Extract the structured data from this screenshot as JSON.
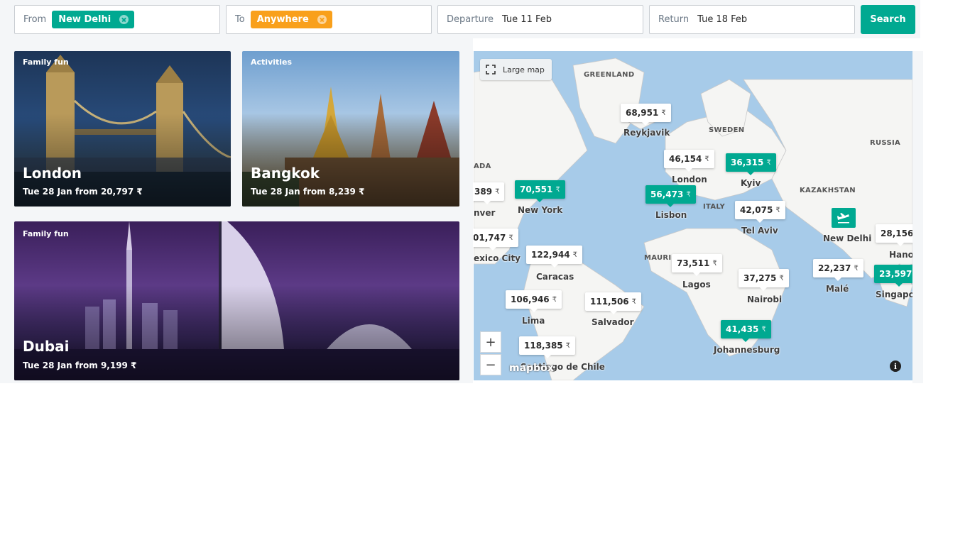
{
  "search": {
    "from_label": "From",
    "from_value": "New Delhi",
    "to_label": "To",
    "to_value": "Anywhere",
    "departure_label": "Departure",
    "departure_value": "Tue 11 Feb",
    "return_label": "Return",
    "return_value": "Tue 18 Feb",
    "search_button": "Search"
  },
  "cards": [
    {
      "tag": "Family fun",
      "city": "London",
      "price": "Tue 28 Jan from 20,797 ₹"
    },
    {
      "tag": "Activities",
      "city": "Bangkok",
      "price": "Tue 28 Jan from 8,239 ₹"
    },
    {
      "tag": "Family fun",
      "city": "Dubai",
      "price": "Tue 28 Jan from 9,199 ₹"
    }
  ],
  "map": {
    "large_map_label": "Large map",
    "zoom_in": "+",
    "zoom_out": "−",
    "attribution": "mapbox",
    "info": "i",
    "currency": "₹",
    "countries": [
      "GREENLAND",
      "SWEDEN",
      "RUSSIA",
      "KAZAKHSTAN",
      "ITALY",
      "ADA",
      "MAURI"
    ],
    "cities": [
      "Reykjavik",
      "London",
      "Kyiv",
      "New York",
      "Lisbon",
      "Tel Aviv",
      "New Delhi",
      "Hano",
      "nver",
      "exico City",
      "Caracas",
      "Lagos",
      "Nairobi",
      "Malé",
      "Singapor",
      "Lima",
      "Salvador",
      "Johannesburg",
      "Santiago de Chile"
    ],
    "prices": [
      {
        "price": "68,951",
        "highlight": false
      },
      {
        "price": "46,154",
        "highlight": false
      },
      {
        "price": "36,315",
        "highlight": true
      },
      {
        "price": "389",
        "highlight": false
      },
      {
        "price": "70,551",
        "highlight": true
      },
      {
        "price": "56,473",
        "highlight": true
      },
      {
        "price": "42,075",
        "highlight": false
      },
      {
        "price": "28,156",
        "highlight": false
      },
      {
        "price": "01,747",
        "highlight": false
      },
      {
        "price": "122,944",
        "highlight": false
      },
      {
        "price": "73,511",
        "highlight": false
      },
      {
        "price": "37,275",
        "highlight": false
      },
      {
        "price": "22,237",
        "highlight": false
      },
      {
        "price": "23,597",
        "highlight": true
      },
      {
        "price": "106,946",
        "highlight": false
      },
      {
        "price": "111,506",
        "highlight": false
      },
      {
        "price": "41,435",
        "highlight": true
      },
      {
        "price": "118,385",
        "highlight": false
      }
    ]
  },
  "colors": {
    "accent": "#00a991",
    "orange": "#f9a01b",
    "sea": "#a7cbe9",
    "land": "#f5f5f3"
  }
}
